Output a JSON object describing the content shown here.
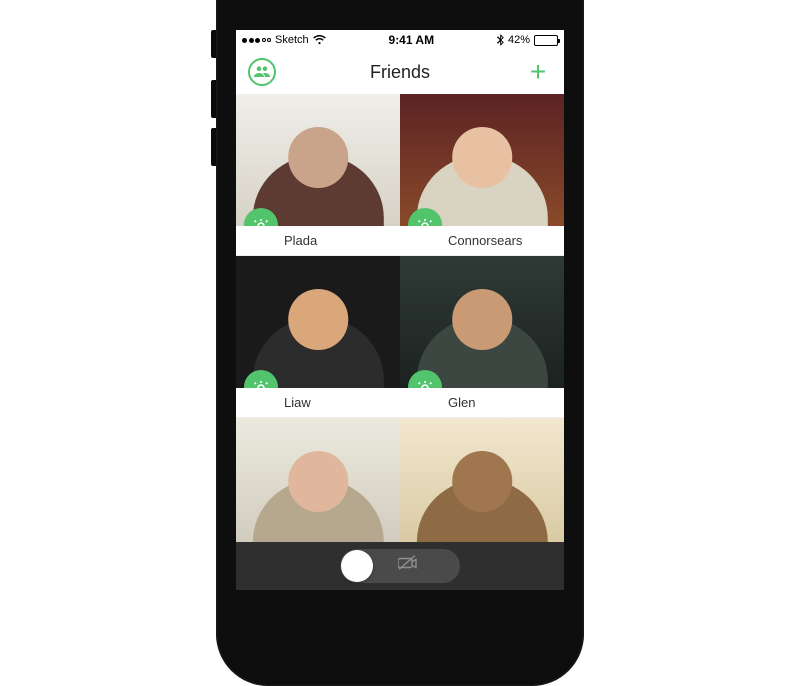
{
  "status_bar": {
    "carrier": "Sketch",
    "time": "9:41 AM",
    "battery_pct": "42%",
    "battery_fill_pct": 42,
    "signal_dots_filled": 3,
    "signal_dots_total": 5
  },
  "navbar": {
    "title": "Friends"
  },
  "friends": [
    {
      "name": "Plada"
    },
    {
      "name": "Connorsears"
    },
    {
      "name": "Liaw"
    },
    {
      "name": "Glen"
    },
    {
      "name": ""
    },
    {
      "name": ""
    }
  ],
  "colors": {
    "accent": "#52c46c",
    "bottom_bar": "#2f2f2f"
  }
}
